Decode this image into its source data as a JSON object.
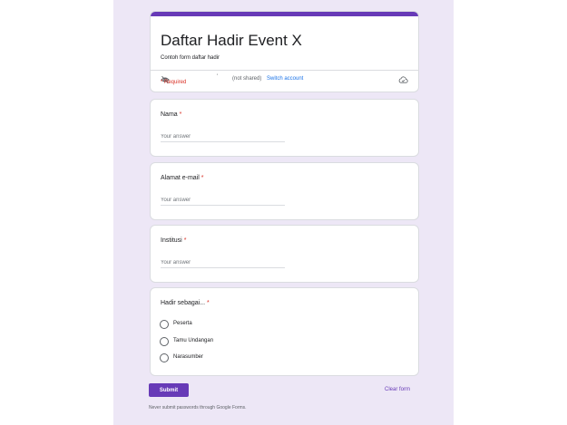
{
  "form": {
    "title": "Daftar Hadir Event X",
    "description": "Contoh form daftar hadir",
    "account_dot": "'",
    "not_shared": "(not shared)",
    "switch_account": "Switch account",
    "required_note": "* Required"
  },
  "questions": [
    {
      "label": "Nama",
      "required_mark": "*",
      "placeholder": "Your answer"
    },
    {
      "label": "Alamat e-mail",
      "required_mark": "*",
      "placeholder": "Your answer"
    },
    {
      "label": "Institusi",
      "required_mark": "*",
      "placeholder": "Your answer"
    }
  ],
  "choice_question": {
    "label": "Hadir sebagai...",
    "required_mark": "*",
    "options": [
      "Peserta",
      "Tamu Undangan",
      "Narasumber"
    ]
  },
  "actions": {
    "submit": "Submit",
    "clear": "Clear form"
  },
  "footer": {
    "note": "Never submit passwords through Google Forms."
  },
  "icons": {
    "visibility": "eye-off-icon",
    "cloud": "cloud-icon"
  },
  "colors": {
    "accent": "#673ab7",
    "background": "#ede7f6",
    "required": "#d93025",
    "link": "#1a73e8"
  }
}
